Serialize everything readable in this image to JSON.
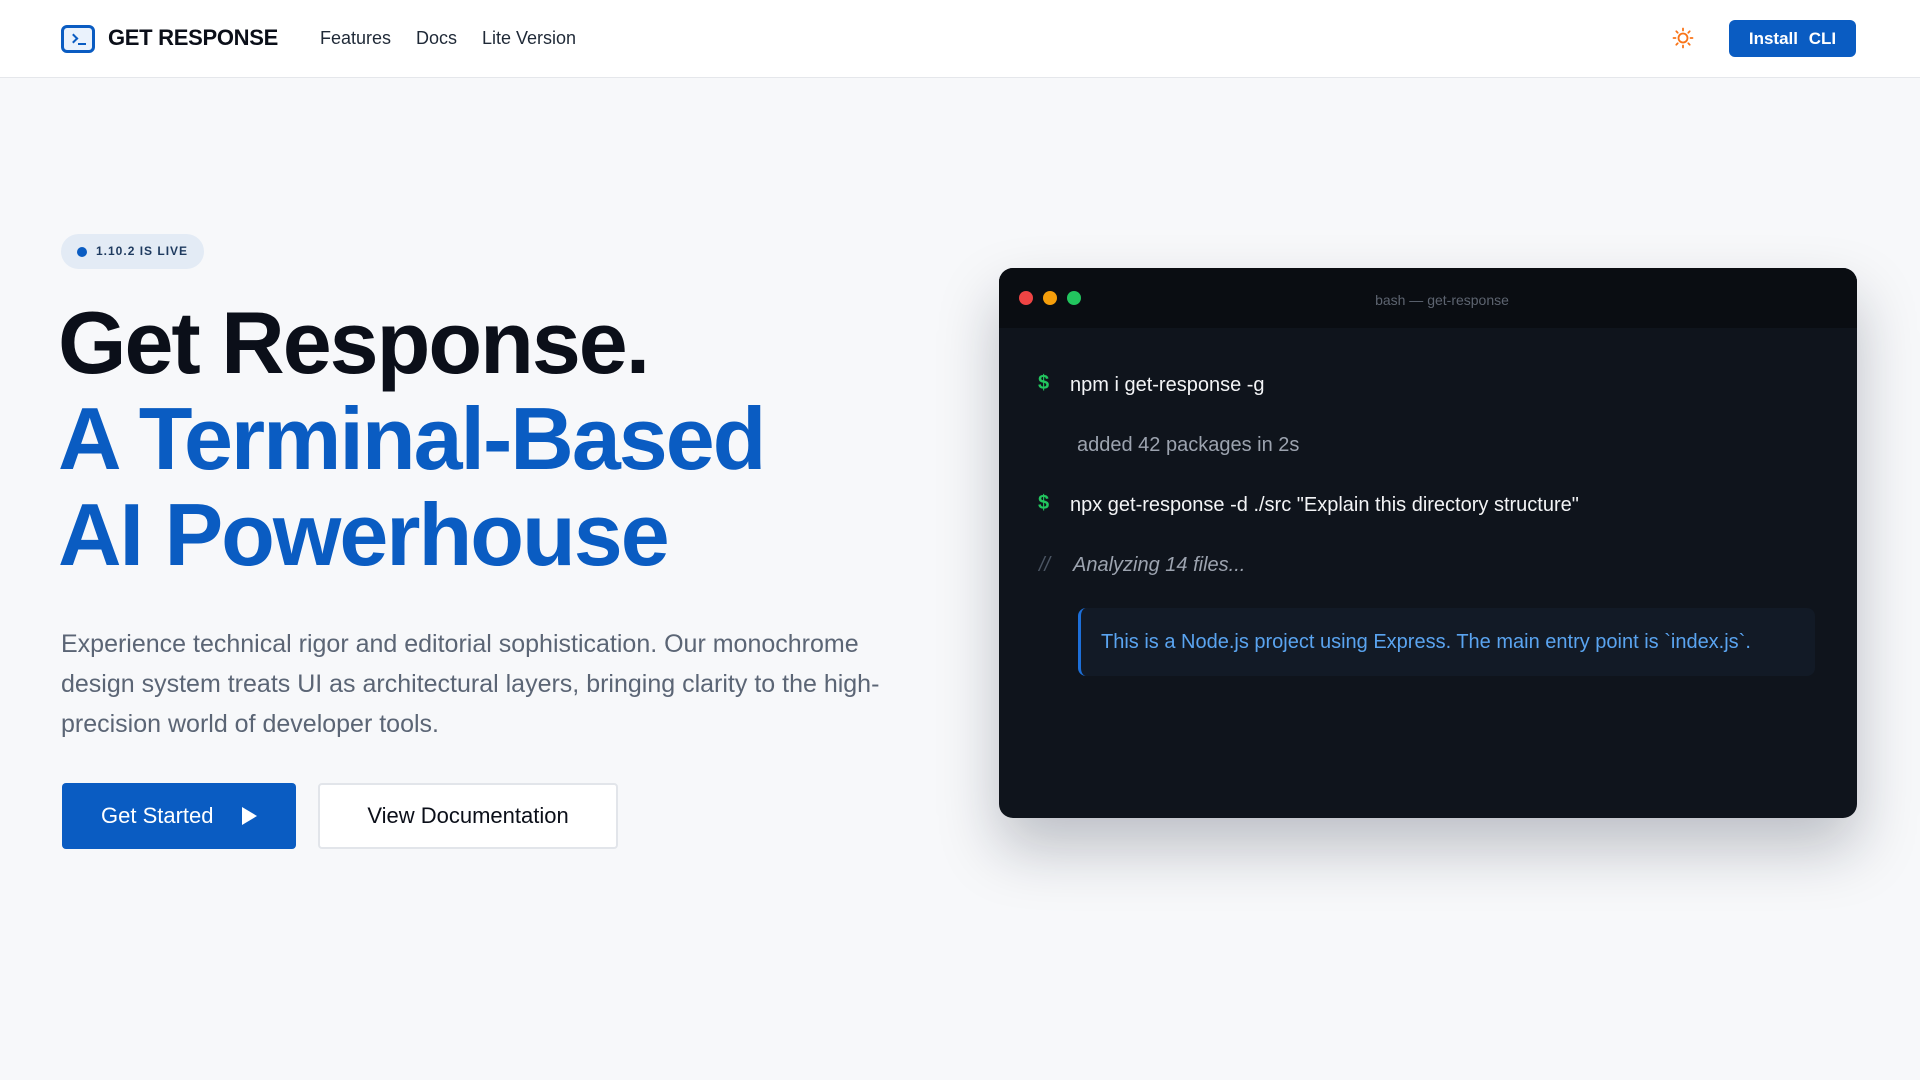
{
  "header": {
    "brand": "GET RESPONSE",
    "nav": [
      "Features",
      "Docs",
      "Lite Version"
    ],
    "install_label": "Install CLI"
  },
  "hero": {
    "badge": "1.10.2 IS LIVE",
    "headline_line1": "Get Response.",
    "headline_line2": "A Terminal-Based",
    "headline_line3": "AI Powerhouse",
    "subtext": "Experience technical rigor and editorial sophistication. Our monochrome design system treats UI as architectural layers, bringing clarity to the high-precision world of developer tools.",
    "primary_button": "Get Started",
    "secondary_button": "View Documentation"
  },
  "terminal": {
    "title": "bash — get-response",
    "prompt_symbol": "$",
    "command1": "npm i get-response -g",
    "output1": "added 42 packages in 2s",
    "command2": "npx get-response -d ./src \"Explain this directory structure\"",
    "comment_marker": "//",
    "comment": "Analyzing 14 files...",
    "response": "This is a Node.js project using Express. The main entry point is `index.js`."
  },
  "colors": {
    "accent": "#0a5cc2",
    "prompt_green": "#22c55e",
    "terminal_bg": "#0f141c",
    "dot_red": "#ef4444",
    "dot_yellow": "#f59e0b",
    "dot_green": "#22c55e",
    "theme_icon": "#f97316"
  }
}
